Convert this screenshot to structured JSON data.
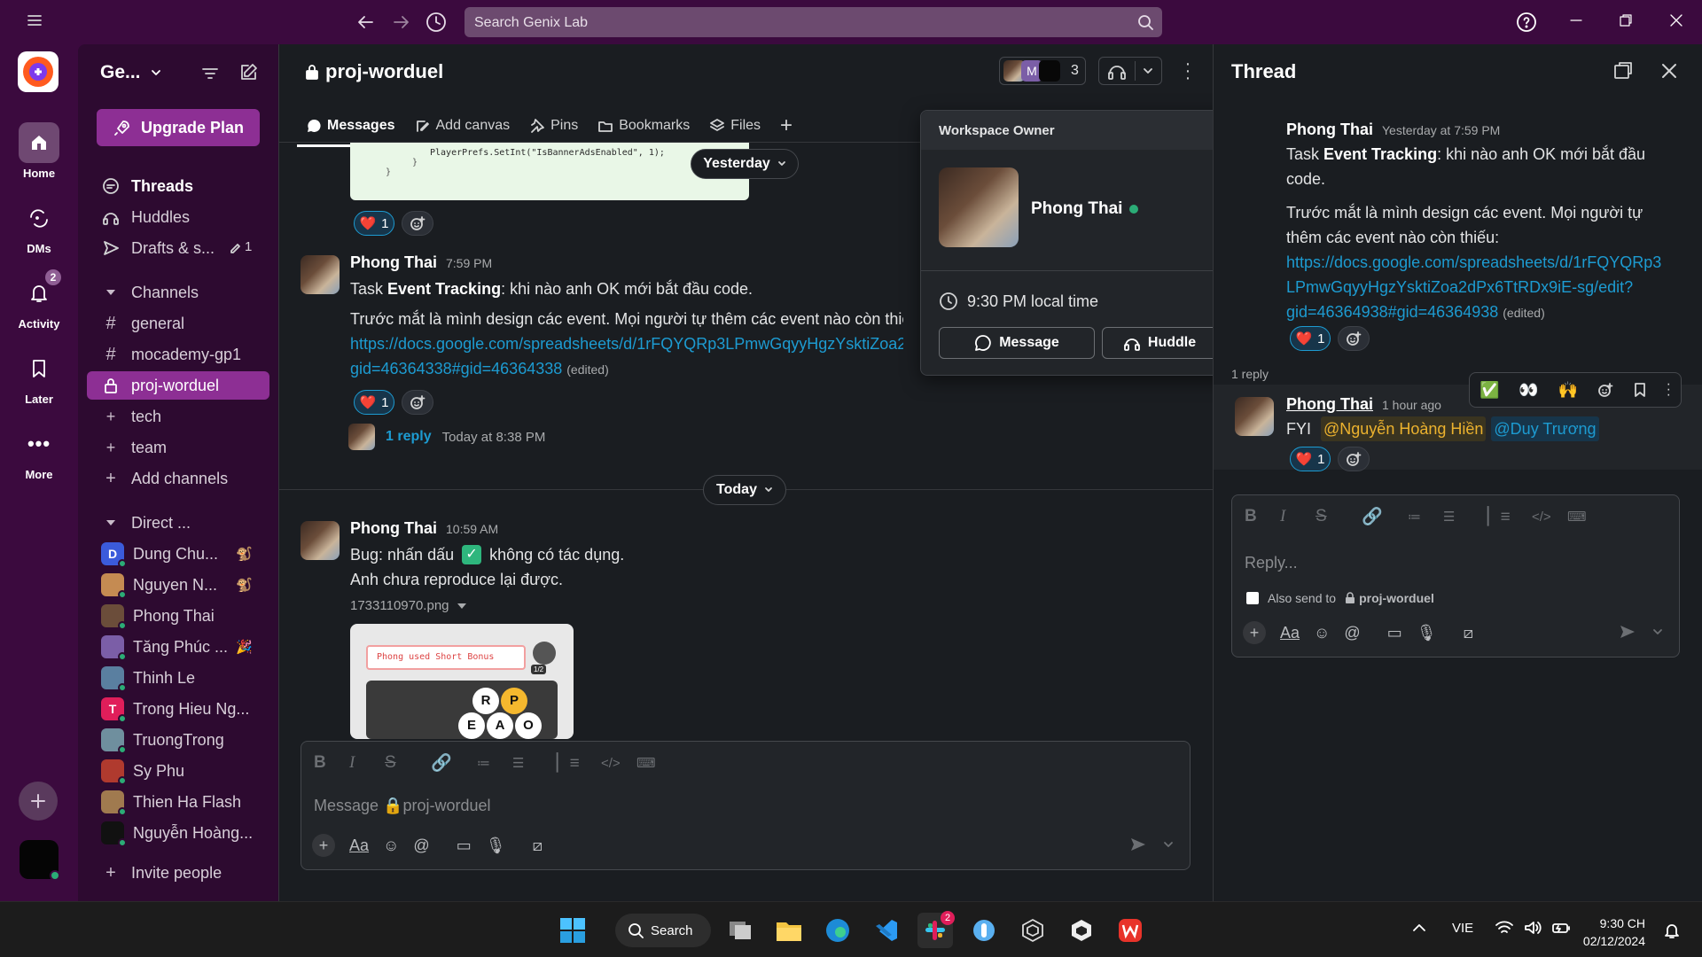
{
  "topbar": {
    "search_placeholder": "Search Genix Lab"
  },
  "rail": {
    "home": "Home",
    "dms": "DMs",
    "activity": "Activity",
    "activity_badge": "2",
    "later": "Later",
    "more": "More"
  },
  "sidebar": {
    "workspace": "Ge...",
    "upgrade": "Upgrade Plan",
    "threads": "Threads",
    "huddles": "Huddles",
    "drafts": "Drafts & s...",
    "drafts_count": "1",
    "channels_header": "Channels",
    "channels": [
      "general",
      "mocademy-gp1",
      "proj-worduel",
      "tech",
      "team"
    ],
    "add_channels": "Add channels",
    "direct_header": "Direct ...",
    "dms": [
      {
        "name": "Dung Chu...",
        "status": "🐒",
        "color": "#3b5bdb",
        "letter": "D"
      },
      {
        "name": "Nguyen N...",
        "status": "🐒",
        "color": "#c58b52",
        "letter": ""
      },
      {
        "name": "Phong Thai",
        "status": "",
        "color": "#6b4d3a",
        "letter": ""
      },
      {
        "name": "Tăng Phúc ...",
        "status": "🎉",
        "color": "#7b5ea7",
        "letter": ""
      },
      {
        "name": "Thinh Le",
        "status": "",
        "color": "#5a7fa0",
        "letter": ""
      },
      {
        "name": "Trong Hieu Ng...",
        "status": "",
        "color": "#e01e5a",
        "letter": "T"
      },
      {
        "name": "TruongTrong",
        "status": "",
        "color": "#6f8f9e",
        "letter": ""
      },
      {
        "name": "Sy Phu",
        "status": "",
        "color": "#b03a2e",
        "letter": ""
      },
      {
        "name": "Thien Ha Flash",
        "status": "",
        "color": "#a07a4f",
        "letter": ""
      },
      {
        "name": "Nguyễn Hoàng...",
        "status": "",
        "color": "#111111",
        "letter": ""
      }
    ],
    "invite": "Invite people"
  },
  "channel": {
    "title": "proj-worduel",
    "member_count": "3",
    "tabs": [
      "Messages",
      "Add canvas",
      "Pins",
      "Bookmarks",
      "Files"
    ],
    "code_line": "PlayerPrefs.SetInt(\"IsBannerAdsEnabled\", 1);",
    "date_yesterday": "Yesterday",
    "date_today": "Today",
    "msg1": {
      "author": "Phong Thai",
      "time": "7:59 PM",
      "line1_a": "Task ",
      "line1_b": "Event Tracking",
      "line1_c": ": khi nào anh OK mới bắt đầu code.",
      "line2": "Trước mắt là mình design các event. Mọi người tự thêm các event nào còn thiế",
      "link1": "https://docs.google.com/spreadsheets/d/1rFQYQRp3LPmwGqyyHgzYsktiZoa2",
      "link2": "gid=46364338#gid=46364338",
      "edited": "(edited)",
      "reaction_count": "1",
      "reply_count": "1 reply",
      "reply_time": "Today at 8:38 PM"
    },
    "above_reaction_count": "1",
    "msg2": {
      "author": "Phong Thai",
      "time": "10:59 AM",
      "line1_a": "Bug: nhấn dấu ",
      "line1_b": " không có tác dụng.",
      "line2": "Anh chưa reproduce lại được.",
      "file": "1733110970.png",
      "game_banner": "Phong used Short Bonus",
      "game_counter": "1/2",
      "tiles": [
        "R",
        "P",
        "E",
        "A",
        "O"
      ]
    },
    "composer_placeholder": "Message 🔒proj-worduel"
  },
  "popup": {
    "header": "Workspace Owner",
    "name": "Phong Thai",
    "local_time": "9:30 PM local time",
    "message_btn": "Message",
    "huddle_btn": "Huddle"
  },
  "thread": {
    "title": "Thread",
    "root": {
      "author": "Phong Thai",
      "time": "Yesterday at 7:59 PM",
      "line1_a": "Task ",
      "line1_b": "Event Tracking",
      "line1_c": ": khi nào anh OK mới bắt đầu",
      "line1_d": "code.",
      "line2": "Trước mắt là mình design các event. Mọi người tự",
      "line3": "thêm các event nào còn thiếu:",
      "link1": "https://docs.google.com/spreadsheets/d/1rFQYQRp3",
      "link2": "LPmwGqyyHgzYsktiZoa2dPx6TtRDx9iE-sg/edit?",
      "link3": "gid=46364938#gid=46364938",
      "edited": "(edited)",
      "reaction_count": "1"
    },
    "replies_label": "1 reply",
    "reply": {
      "author": "Phong Thai",
      "time": "1 hour ago",
      "prefix": "FYI ",
      "mention1": "@Nguyễn Hoàng Hiền",
      "mention2": "@Duy Trương",
      "reaction_count": "1"
    },
    "composer_placeholder": "Reply...",
    "also_send": "Also send to",
    "also_send_channel": "proj-worduel"
  },
  "taskbar": {
    "search": "Search",
    "lang": "VIE",
    "time": "9:30 CH",
    "date": "02/12/2024",
    "slack_badge": "2"
  },
  "colors": {
    "aubergine": "#3b0a3e",
    "sidebar": "#2d0a30",
    "selected": "#8d2f94",
    "main_bg": "#1a1d21",
    "link": "#1d9bd1",
    "mention": "#ecb22e"
  }
}
